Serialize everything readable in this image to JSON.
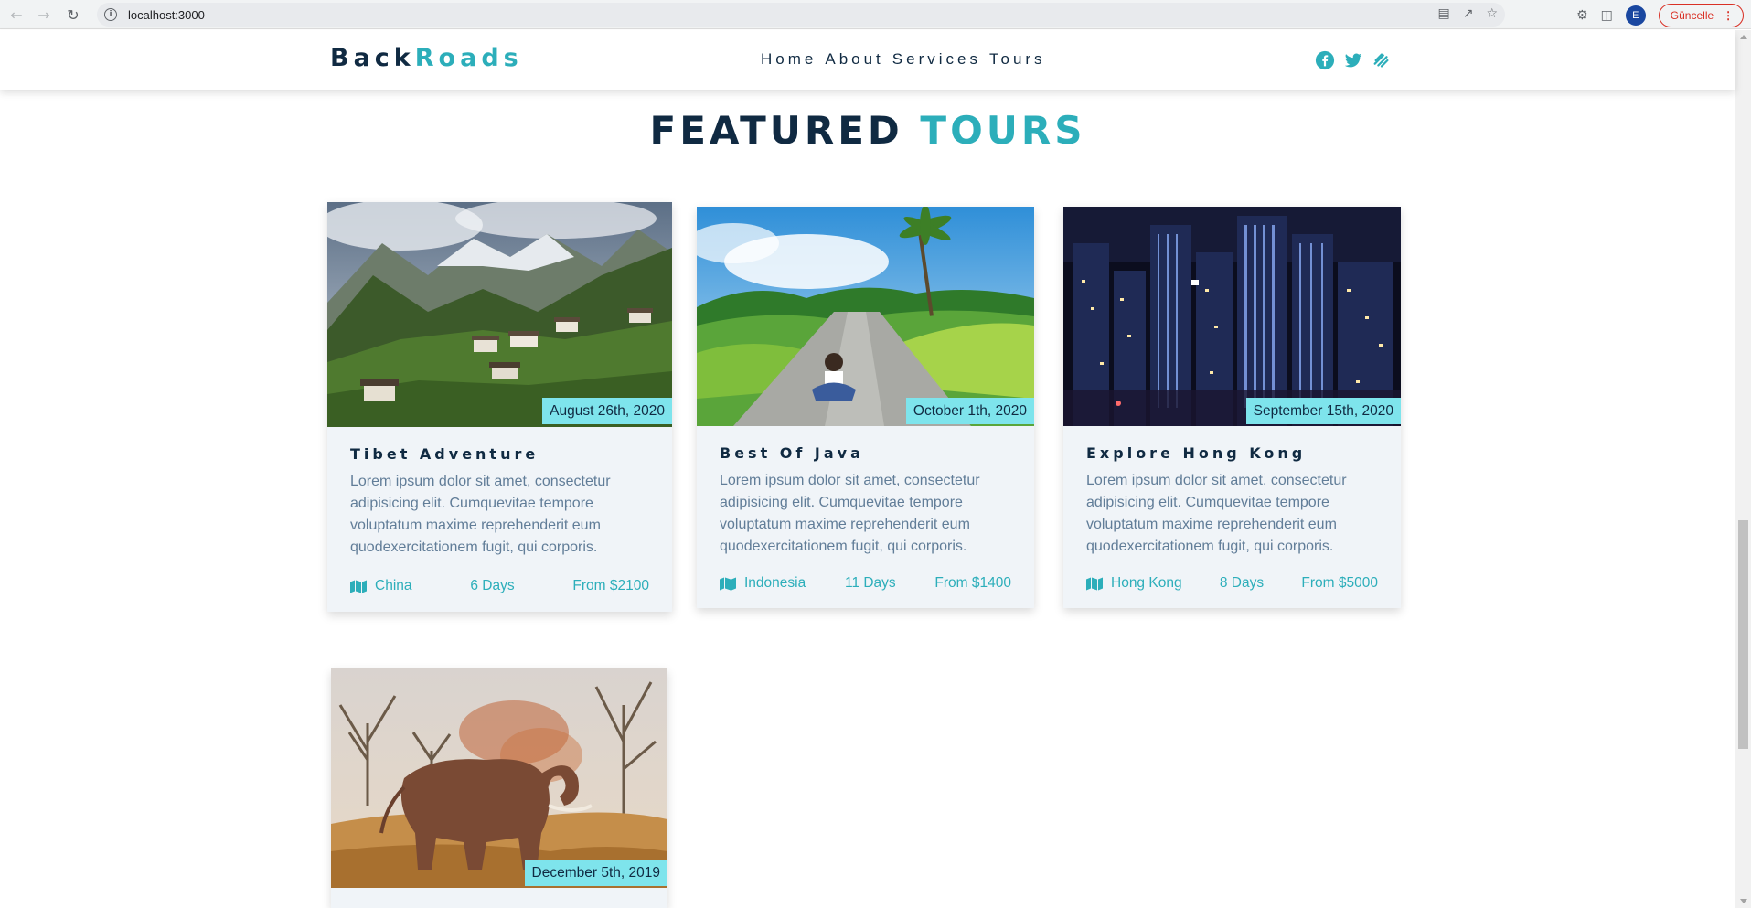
{
  "browser": {
    "url": "localhost:3000",
    "profile_initial": "E",
    "update_label": "Güncelle"
  },
  "site": {
    "logo_part1": "Back",
    "logo_part2": "Roads",
    "nav_links": [
      "Home",
      "About",
      "Services",
      "Tours"
    ],
    "social_icons": [
      "facebook-icon",
      "twitter-icon",
      "squarespace-icon"
    ],
    "accent_color": "#2caeba",
    "heading_color": "#102a42"
  },
  "section": {
    "title_part1": "FEATURED",
    "title_part2": "TOURS"
  },
  "tours": [
    {
      "date": "August 26th, 2020",
      "name": "Tibet Adventure",
      "description": "Lorem ipsum dolor sit amet, consectetur adipisicing elit. Cumquevitae tempore voluptatum maxime reprehenderit eum quodexercitationem fugit, qui corporis.",
      "location": "China",
      "duration": "6 Days",
      "price": "From $2100"
    },
    {
      "date": "October 1th, 2020",
      "name": "Best Of Java",
      "description": "Lorem ipsum dolor sit amet, consectetur adipisicing elit. Cumquevitae tempore voluptatum maxime reprehenderit eum quodexercitationem fugit, qui corporis.",
      "location": "Indonesia",
      "duration": "11 Days",
      "price": "From $1400"
    },
    {
      "date": "September 15th, 2020",
      "name": "Explore Hong Kong",
      "description": "Lorem ipsum dolor sit amet, consectetur adipisicing elit. Cumquevitae tempore voluptatum maxime reprehenderit eum quodexercitationem fugit, qui corporis.",
      "location": "Hong Kong",
      "duration": "8 Days",
      "price": "From $5000"
    },
    {
      "date": "December 5th, 2019"
    }
  ]
}
